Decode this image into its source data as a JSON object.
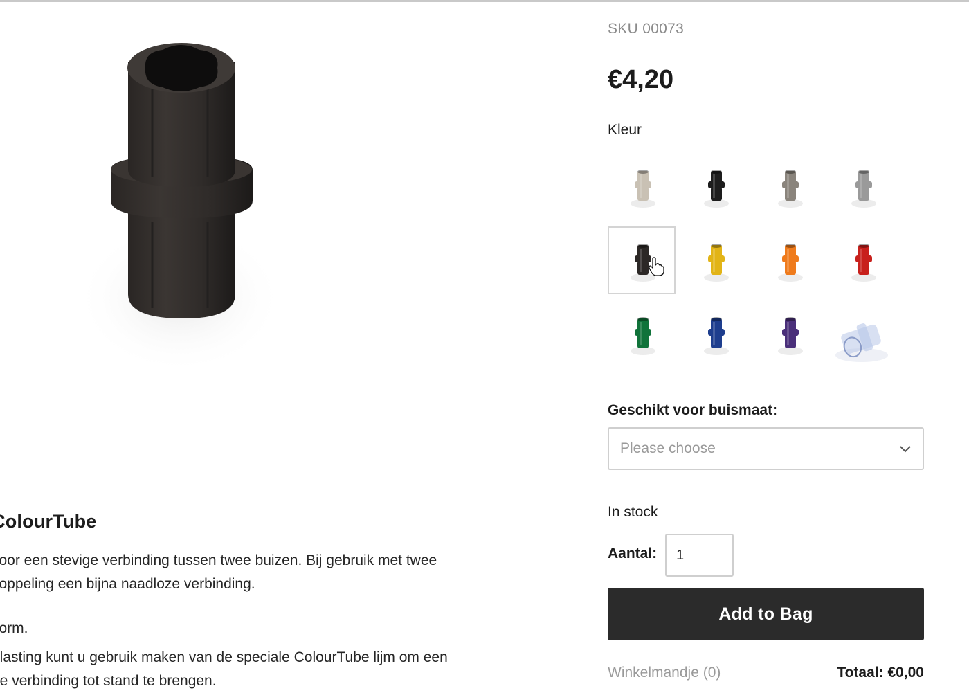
{
  "product": {
    "sku": "SKU 00073",
    "price": "€4,20",
    "image_icon": "colourtube-connector-image"
  },
  "color": {
    "label": "Kleur",
    "selected_index": 4,
    "options": [
      {
        "name": "beige",
        "hex": "#c9c1b4"
      },
      {
        "name": "black",
        "hex": "#1d1d1d"
      },
      {
        "name": "grey",
        "hex": "#8a847c"
      },
      {
        "name": "light-grey",
        "hex": "#9a9a9a"
      },
      {
        "name": "dark-brown",
        "hex": "#2c2826"
      },
      {
        "name": "yellow",
        "hex": "#e2b417"
      },
      {
        "name": "orange",
        "hex": "#ef7b1c"
      },
      {
        "name": "red",
        "hex": "#c8201c"
      },
      {
        "name": "green",
        "hex": "#10733a"
      },
      {
        "name": "blue",
        "hex": "#1e3e8e"
      },
      {
        "name": "purple",
        "hex": "#4a2f7a"
      },
      {
        "name": "transparent",
        "hex": "#b8c6e8"
      }
    ]
  },
  "tube_size": {
    "label": "Geschikt voor buismaat:",
    "placeholder": "Please choose"
  },
  "stock": {
    "status": "In stock"
  },
  "quantity": {
    "label": "Aantal:",
    "value": "1"
  },
  "cart": {
    "add_button": "Add to Bag",
    "link": "Winkelmandje (0)",
    "total": "Totaal: €0,00"
  },
  "description": {
    "title": "ColourTube",
    "paragraph1_line1": "voor een stevige verbinding tussen twee buizen. Bij gebruik met twee",
    "paragraph1_line2": "koppeling een bijna naadloze verbinding.",
    "paragraph2": "vorm.",
    "paragraph3_line1": "elasting kunt u gebruik maken van de speciale ColourTube lijm om een",
    "paragraph3_line2": "ne verbinding tot stand te brengen."
  }
}
